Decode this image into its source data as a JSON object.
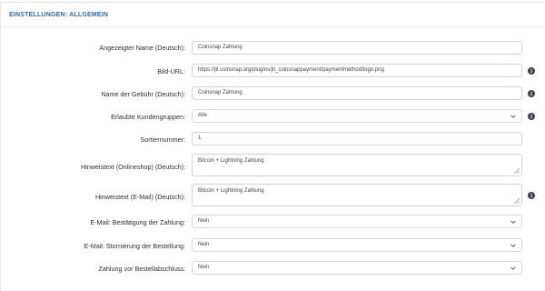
{
  "section": {
    "title": "EINSTELLUNGEN: ALLGEMEIN"
  },
  "fields": {
    "name_de": {
      "label": "Angezeigter Name (Deutsch):",
      "value": "Coinsnap Zahlung"
    },
    "bild_url": {
      "label": "Bild-URL:",
      "value": "https://jtl.coinsnap.org/plugins/jtl_coinsnappayment/paymentmethod/logo.png"
    },
    "gebuehr_de": {
      "label": "Name der Gebühr (Deutsch):",
      "value": "Coinsnap Zahlung"
    },
    "kundengruppen": {
      "label": "Erlaubte Kundengruppen:",
      "value": "Alle"
    },
    "sortier": {
      "label": "Sortiernummer:",
      "value": "1"
    },
    "hinweis_shop": {
      "label": "Hinweistext (Onlineshop) (Deutsch):",
      "value": "Bitcoin + Lightning Zahlung"
    },
    "hinweis_mail": {
      "label": "Hinweistext (E-Mail) (Deutsch):",
      "value": "Bitcoin + Lightning Zahlung"
    },
    "mail_bestaet": {
      "label": "E-Mail: Bestätigung der Zahlung:",
      "value": "Nein"
    },
    "mail_storno": {
      "label": "E-Mail: Stornierung der Bestellung:",
      "value": "Nein"
    },
    "vor_abschluss": {
      "label": "Zahlung vor Bestellabschluss:",
      "value": "Nein"
    }
  },
  "icons": {
    "info": "info-icon",
    "chevron": "chevron-down-icon",
    "resize": "resize-handle-icon"
  },
  "colors": {
    "accent": "#2f69a8",
    "border": "#cfd5dc",
    "icon": "#3b4250"
  }
}
